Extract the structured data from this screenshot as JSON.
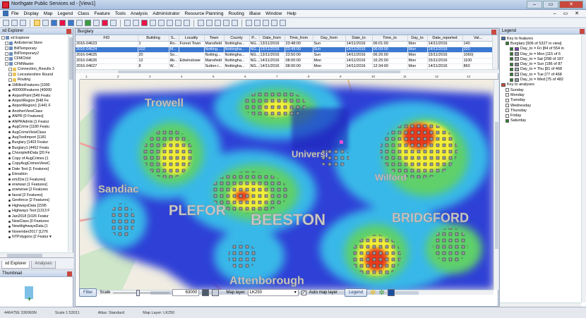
{
  "window": {
    "title": "Northgate Public Services xd - [View1]",
    "min_label": "–",
    "max_label": "▭",
    "close_label": "✕"
  },
  "menu": [
    "File",
    "Display",
    "Map",
    "Legend",
    "Class",
    "Feature",
    "Tools",
    "Analysis",
    "Administrator",
    "Resource Planning",
    "Routing",
    "iBase",
    "Window",
    "Help"
  ],
  "menu_mdi": "– ▭ ✕",
  "explorer": {
    "title": "xd Explorer",
    "items": [
      {
        "label": "xd Explorer",
        "kind": "db",
        "indent": 0
      },
      {
        "label": "AnExternal Store",
        "kind": "db",
        "indent": 1
      },
      {
        "label": "BillTemporary",
        "kind": "db",
        "indent": 1
      },
      {
        "label": "BillTemporary2",
        "kind": "db",
        "indent": 1
      },
      {
        "label": "CFMChild",
        "kind": "db",
        "indent": 1
      },
      {
        "label": "CFMMaster",
        "kind": "db",
        "indent": 1
      },
      {
        "label": "Connection_Results 3",
        "kind": "fold",
        "indent": 2
      },
      {
        "label": "Leicestershire Round",
        "kind": "fold",
        "indent": 2
      },
      {
        "label": "Routing",
        "kind": "fold",
        "indent": 2
      },
      {
        "label": "1MillionFeatures [1000",
        "kind": "dot",
        "indent": 2
      },
      {
        "label": "400000Features [40000",
        "kind": "dot",
        "indent": 2
      },
      {
        "label": "AirportPoint [549 Featu",
        "kind": "dot",
        "indent": 2
      },
      {
        "label": "AirportRegion [548 Fe",
        "kind": "dot",
        "indent": 2
      },
      {
        "label": "AirportRegion1 [1441 F",
        "kind": "dot",
        "indent": 2
      },
      {
        "label": "AnotherViewClass",
        "kind": "dot",
        "indent": 2
      },
      {
        "label": "ANPR [0 Features]",
        "kind": "dot",
        "indent": 2
      },
      {
        "label": "ANPRAdmin [1 Featur",
        "kind": "dot",
        "indent": 2
      },
      {
        "label": "AugCrime [1180 Featu",
        "kind": "dot",
        "indent": 2
      },
      {
        "label": "AugCrimeViewClass",
        "kind": "dot",
        "indent": 2
      },
      {
        "label": "AugTestImport [1181",
        "kind": "dot",
        "indent": 2
      },
      {
        "label": "Burglary [1403 Featur",
        "kind": "dot",
        "indent": 2
      },
      {
        "label": "Burglary1 [4452 Featu",
        "kind": "dot",
        "indent": 2
      },
      {
        "label": "ChoroplethData [20 Fe",
        "kind": "dot",
        "indent": 2
      },
      {
        "label": "Copy of AugCrimes [1",
        "kind": "dot",
        "indent": 2
      },
      {
        "label": "CopyAugCrimesViewC",
        "kind": "dot",
        "indent": 2
      },
      {
        "label": "Date Test [1 Features]",
        "kind": "dot",
        "indent": 2
      },
      {
        "label": "Elevation",
        "kind": "dot",
        "indent": 2
      },
      {
        "label": "em31te [1 Features]",
        "kind": "dot",
        "indent": 2
      },
      {
        "label": "erwrwan [1 Features]",
        "kind": "dot",
        "indent": 2
      },
      {
        "label": "erwrwrwe [2 Features",
        "kind": "dot",
        "indent": 2
      },
      {
        "label": "fasssl [2 Features]",
        "kind": "dot",
        "indent": 2
      },
      {
        "label": "Geofence [2 Features]",
        "kind": "dot",
        "indent": 2
      },
      {
        "label": "HighwaysData [1595",
        "kind": "dot",
        "indent": 2
      },
      {
        "label": "Highways Test [1313 F",
        "kind": "dot",
        "indent": 2
      },
      {
        "label": "Jan2018 [1026 Featur",
        "kind": "dot",
        "indent": 2
      },
      {
        "label": "NewClass [0 Features",
        "kind": "dot",
        "indent": 2
      },
      {
        "label": "NewHighwaysData [1",
        "kind": "dot",
        "indent": 2
      },
      {
        "label": "November2017 [1276",
        "kind": "dot",
        "indent": 2
      },
      {
        "label": "NTPolygons [2 Featur ▾",
        "kind": "dot",
        "indent": 2
      }
    ],
    "tabs": [
      "xd Explorer",
      "Analyses"
    ]
  },
  "thumbnail": {
    "title": "Thumbnail"
  },
  "table_window": {
    "title": "Burglary",
    "columns": [
      "FID",
      "Building",
      "S...",
      "Locality",
      "Town",
      "County",
      "P...",
      "Date_from",
      "Time_from",
      "Day_from",
      "Date_to",
      "Time_to",
      "Day_to",
      "Date_reported",
      "Val..."
    ],
    "rows": [
      [
        "2016-04623",
        "1",
        "Ro...",
        "Forest Town",
        "Mansfield",
        "Nottingha...",
        "NG...",
        "13/11/2016",
        "23:48:00",
        "Sun",
        "14/11/2016",
        "06:01:00",
        "Mon",
        "14/11/2016",
        "140"
      ],
      [
        "2016-04624",
        "102",
        "M...",
        "",
        "Notting...",
        "Nottingha...",
        "NG...",
        "13/11/2016",
        "23:49:00",
        "Sun",
        "14/11/2016",
        "06:09:00",
        "Mon",
        "14/11/2016",
        "320"
      ],
      [
        "2016-04625",
        "20",
        "So...",
        "",
        "Notting...",
        "Nottingha...",
        "NG...",
        "13/11/2016",
        "23:50:00",
        "Sun",
        "14/11/2016",
        "06:26:00",
        "Mon",
        "15/11/2016",
        "1060("
      ],
      [
        "2016-04626",
        "12",
        "Ab...",
        "Edwinstowe",
        "Mansfield",
        "Nottingha...",
        "NG...",
        "14/11/2016",
        "08:00:00",
        "Mon",
        "14/11/2016",
        "16:25:00",
        "Mon",
        "15/11/2016",
        "1100"
      ],
      [
        "2016-04627",
        "8",
        "W...",
        "",
        "Sutton-i...",
        "Nottingha...",
        "NG...",
        "14/11/2016",
        "08:00:00",
        "Mon",
        "14/11/2016",
        "12:34:00",
        "Mon",
        "14/11/2016",
        "860"
      ]
    ],
    "selected_row": 1
  },
  "ruler": [
    "1",
    "2",
    "3",
    "4",
    "5",
    "6",
    "7",
    "8",
    "9",
    "10",
    "11",
    "12",
    "13"
  ],
  "map_labels": {
    "trowell": "Trowell",
    "beeston": "BEESTON",
    "attenborough": "Attenborough",
    "bridgford": "BRIDGFORD",
    "university": "Universi",
    "wilford": "Wilford",
    "sandiacre": "Sandiac",
    "stapleford": "PLEFOR"
  },
  "map_controls": {
    "filter_label": "Filter",
    "scale_label": "Scale",
    "scale_value": "63000",
    "map_layer_label": "Map layer",
    "map_layer_value": "LK250",
    "auto_map_layer_label": "Auto map layer",
    "legend_label": "Legend"
  },
  "legend": {
    "title": "Legend",
    "items": [
      {
        "label": "Key to features",
        "type": "head",
        "indent": 0
      },
      {
        "label": "Burglary [906 of 5327 in view]",
        "type": "cb",
        "on": true,
        "indent": 1
      },
      {
        "label": "Day_to = Fri [84 of 554 in",
        "type": "sw",
        "color": "#7a4bb8",
        "indent": 2
      },
      {
        "label": "Day_to = Mon [115 of 6",
        "type": "sw",
        "color": "#9aa1ad",
        "indent": 2
      },
      {
        "label": "Day_to = Sat [298 of 187",
        "type": "sw",
        "color": "#b8bcc4",
        "indent": 2
      },
      {
        "label": "Day_to = Sun [186 of 87",
        "type": "sw",
        "color": "#8a8f98",
        "indent": 2
      },
      {
        "label": "Day_to = Thu [81 of 468",
        "type": "sw",
        "color": "#a7acb5",
        "indent": 2
      },
      {
        "label": "Day_to = Tue [77 of 468",
        "type": "sw",
        "color": "#bfc3ca",
        "indent": 2
      },
      {
        "label": "Day_to = Wed [75 of 482",
        "type": "sw",
        "color": "#969ba4",
        "indent": 2
      },
      {
        "label": "Key to analyses",
        "type": "head",
        "indent": 0
      },
      {
        "label": "Sunday",
        "type": "cb",
        "on": false,
        "indent": 1
      },
      {
        "label": "Monday",
        "type": "cb",
        "on": false,
        "indent": 1
      },
      {
        "label": "Tuesday",
        "type": "cb",
        "on": false,
        "indent": 1
      },
      {
        "label": "Wednesday",
        "type": "cb",
        "on": false,
        "indent": 1
      },
      {
        "label": "Thursday",
        "type": "cb",
        "on": false,
        "indent": 1
      },
      {
        "label": "Friday",
        "type": "cb",
        "on": false,
        "indent": 1
      },
      {
        "label": "Saturday",
        "type": "cb",
        "on": true,
        "indent": 1
      }
    ]
  },
  "status": {
    "coords": "446475E 336960N",
    "scale": "Scale 1:53011",
    "atlas": "Atlas: Standard",
    "map_layer": "Map Layer: LK250"
  },
  "colors": {
    "heat_low": "#2f3fd6",
    "heat_mid": "#38b8e8",
    "heat_green": "#5fd06a",
    "heat_yellow": "#f2ee3a",
    "heat_high": "#e83a1a",
    "selected_row": "#3b79d3"
  }
}
